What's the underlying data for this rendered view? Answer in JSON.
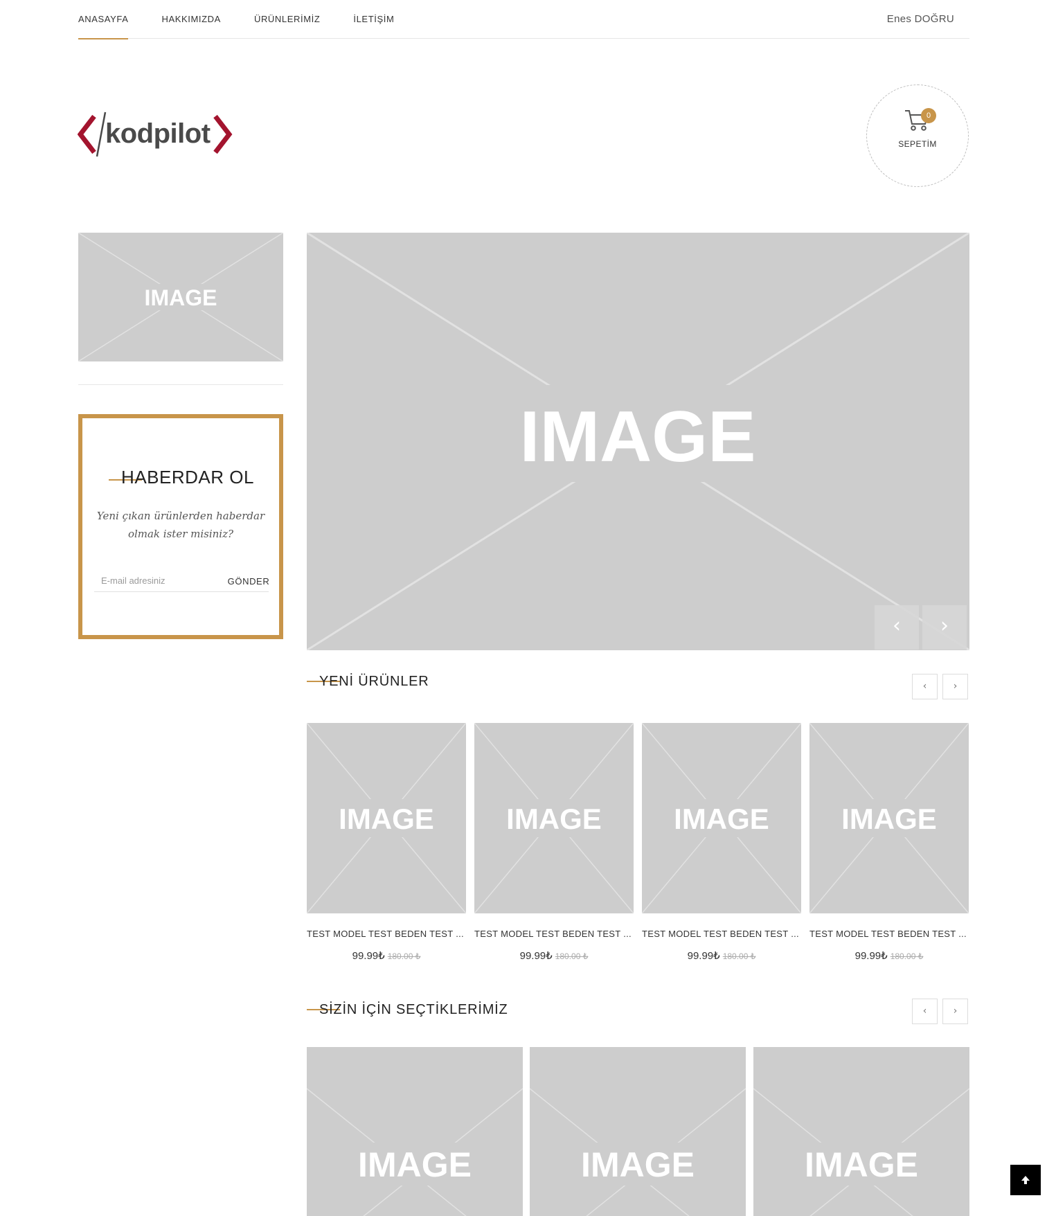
{
  "nav": {
    "items": [
      {
        "label": "ANASAYFA",
        "active": true
      },
      {
        "label": "HAKKIMIZDA",
        "active": false
      },
      {
        "label": "ÜRÜNLERİMİZ",
        "active": false
      },
      {
        "label": "İLETİŞİM",
        "active": false
      }
    ],
    "user": "Enes DOĞRU"
  },
  "brand": {
    "logo_text": "kodpilot",
    "colors": {
      "accent": "#c8954a",
      "logo_bracket": "#a3142e",
      "logo_text": "#4a4a4a"
    }
  },
  "cart": {
    "label": "SEPETİM",
    "count": "0",
    "icon": "cart-icon"
  },
  "placeholder_text": "IMAGE",
  "newsletter": {
    "title": "HABERDAR OL",
    "subtitle": "Yeni çıkan ürünlerden haberdar olmak ister misiniz?",
    "email_placeholder": "E-mail adresiniz",
    "button": "GÖNDER"
  },
  "slider": {
    "prev_icon": "chevron-left-icon",
    "next_icon": "chevron-right-icon"
  },
  "sections": {
    "new_products": {
      "title": "YENİ ÜRÜNLER",
      "products": [
        {
          "name": "TEST MODEL TEST BEDEN TEST ...",
          "price": "99.99₺",
          "old_price": "180.00 ₺"
        },
        {
          "name": "TEST MODEL TEST BEDEN TEST ...",
          "price": "99.99₺",
          "old_price": "180.00 ₺"
        },
        {
          "name": "TEST MODEL TEST BEDEN TEST ...",
          "price": "99.99₺",
          "old_price": "180.00 ₺"
        },
        {
          "name": "TEST MODEL TEST BEDEN TEST ...",
          "price": "99.99₺",
          "old_price": "180.00 ₺"
        }
      ]
    },
    "picks": {
      "title": "SİZİN İÇİN SEÇTİKLERİMİZ"
    }
  },
  "back_to_top_icon": "arrow-up-icon"
}
